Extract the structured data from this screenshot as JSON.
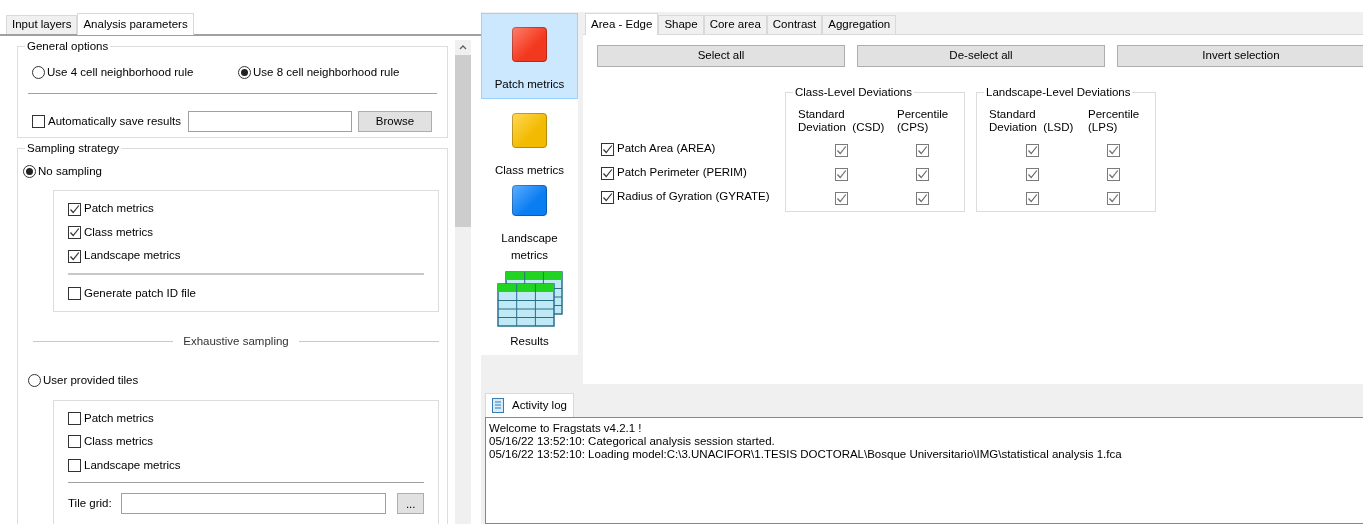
{
  "left_tabs": [
    {
      "label": "Input layers",
      "selected": false
    },
    {
      "label": "Analysis parameters",
      "selected": true
    }
  ],
  "general_options": {
    "title": "General options",
    "neighborhood": [
      {
        "label": "Use 4 cell neighborhood rule",
        "selected": false
      },
      {
        "label": "Use 8 cell neighborhood rule",
        "selected": true
      }
    ],
    "auto_save": {
      "label": "Automatically save results",
      "checked": false
    },
    "browse_button": "Browse"
  },
  "sampling": {
    "title": "Sampling strategy",
    "no_sampling": {
      "label": "No sampling",
      "selected": true,
      "options": [
        {
          "label": "Patch metrics",
          "checked": true
        },
        {
          "label": "Class metrics",
          "checked": true
        },
        {
          "label": "Landscape metrics",
          "checked": true
        }
      ],
      "patch_id": {
        "label": "Generate patch ID file",
        "checked": false
      }
    },
    "exhaustive_label": "Exhaustive sampling",
    "user_tiles": {
      "label": "User provided tiles",
      "selected": false,
      "options": [
        {
          "label": "Patch metrics",
          "checked": false
        },
        {
          "label": "Class metrics",
          "checked": false
        },
        {
          "label": "Landscape metrics",
          "checked": false
        }
      ]
    },
    "tile_grid": {
      "label": "Tile grid:",
      "button": "..."
    }
  },
  "nav": [
    {
      "label": "Patch metrics",
      "selected": true,
      "kind": "square",
      "color": "#ff3b1f"
    },
    {
      "label": "Class metrics",
      "selected": false,
      "kind": "square",
      "color": "#ffc400"
    },
    {
      "label": "Landscape metrics",
      "selected": false,
      "kind": "square",
      "color": "#0a84ff"
    },
    {
      "label": "Results",
      "selected": false,
      "kind": "table"
    }
  ],
  "metric_tabs": [
    {
      "label": "Area - Edge",
      "selected": true
    },
    {
      "label": "Shape",
      "selected": false
    },
    {
      "label": "Core area",
      "selected": false
    },
    {
      "label": "Contrast",
      "selected": false
    },
    {
      "label": "Aggregation",
      "selected": false
    }
  ],
  "actions": [
    "Select all",
    "De-select all",
    "Invert selection"
  ],
  "deviation_groups": [
    {
      "title": "Class-Level Deviations",
      "columns": [
        [
          "Standard",
          "Deviation  (CSD)"
        ],
        [
          "Percentile",
          "(CPS)"
        ]
      ]
    },
    {
      "title": "Landscape-Level Deviations",
      "columns": [
        [
          "Standard",
          "Deviation  (LSD)"
        ],
        [
          "Percentile",
          "(LPS)"
        ]
      ]
    }
  ],
  "metrics": [
    {
      "label": "Patch Area  (AREA)",
      "checked": true,
      "deviations": [
        true,
        true,
        true,
        true
      ]
    },
    {
      "label": "Patch Perimeter  (PERIM)",
      "checked": true,
      "deviations": [
        true,
        true,
        true,
        true
      ]
    },
    {
      "label": "Radius of Gyration  (GYRATE)",
      "checked": true,
      "deviations": [
        true,
        true,
        true,
        true
      ]
    }
  ],
  "log": {
    "tab": "Activity log",
    "lines": [
      "Welcome to Fragstats v4.2.1 !",
      "05/16/22 13:52:10: Categorical analysis session started.",
      "05/16/22 13:52:10: Loading model:C:\\3.UNACIFOR\\1.TESIS DOCTORAL\\Bosque Universitario\\IMG\\statistical analysis 1.fca"
    ]
  }
}
